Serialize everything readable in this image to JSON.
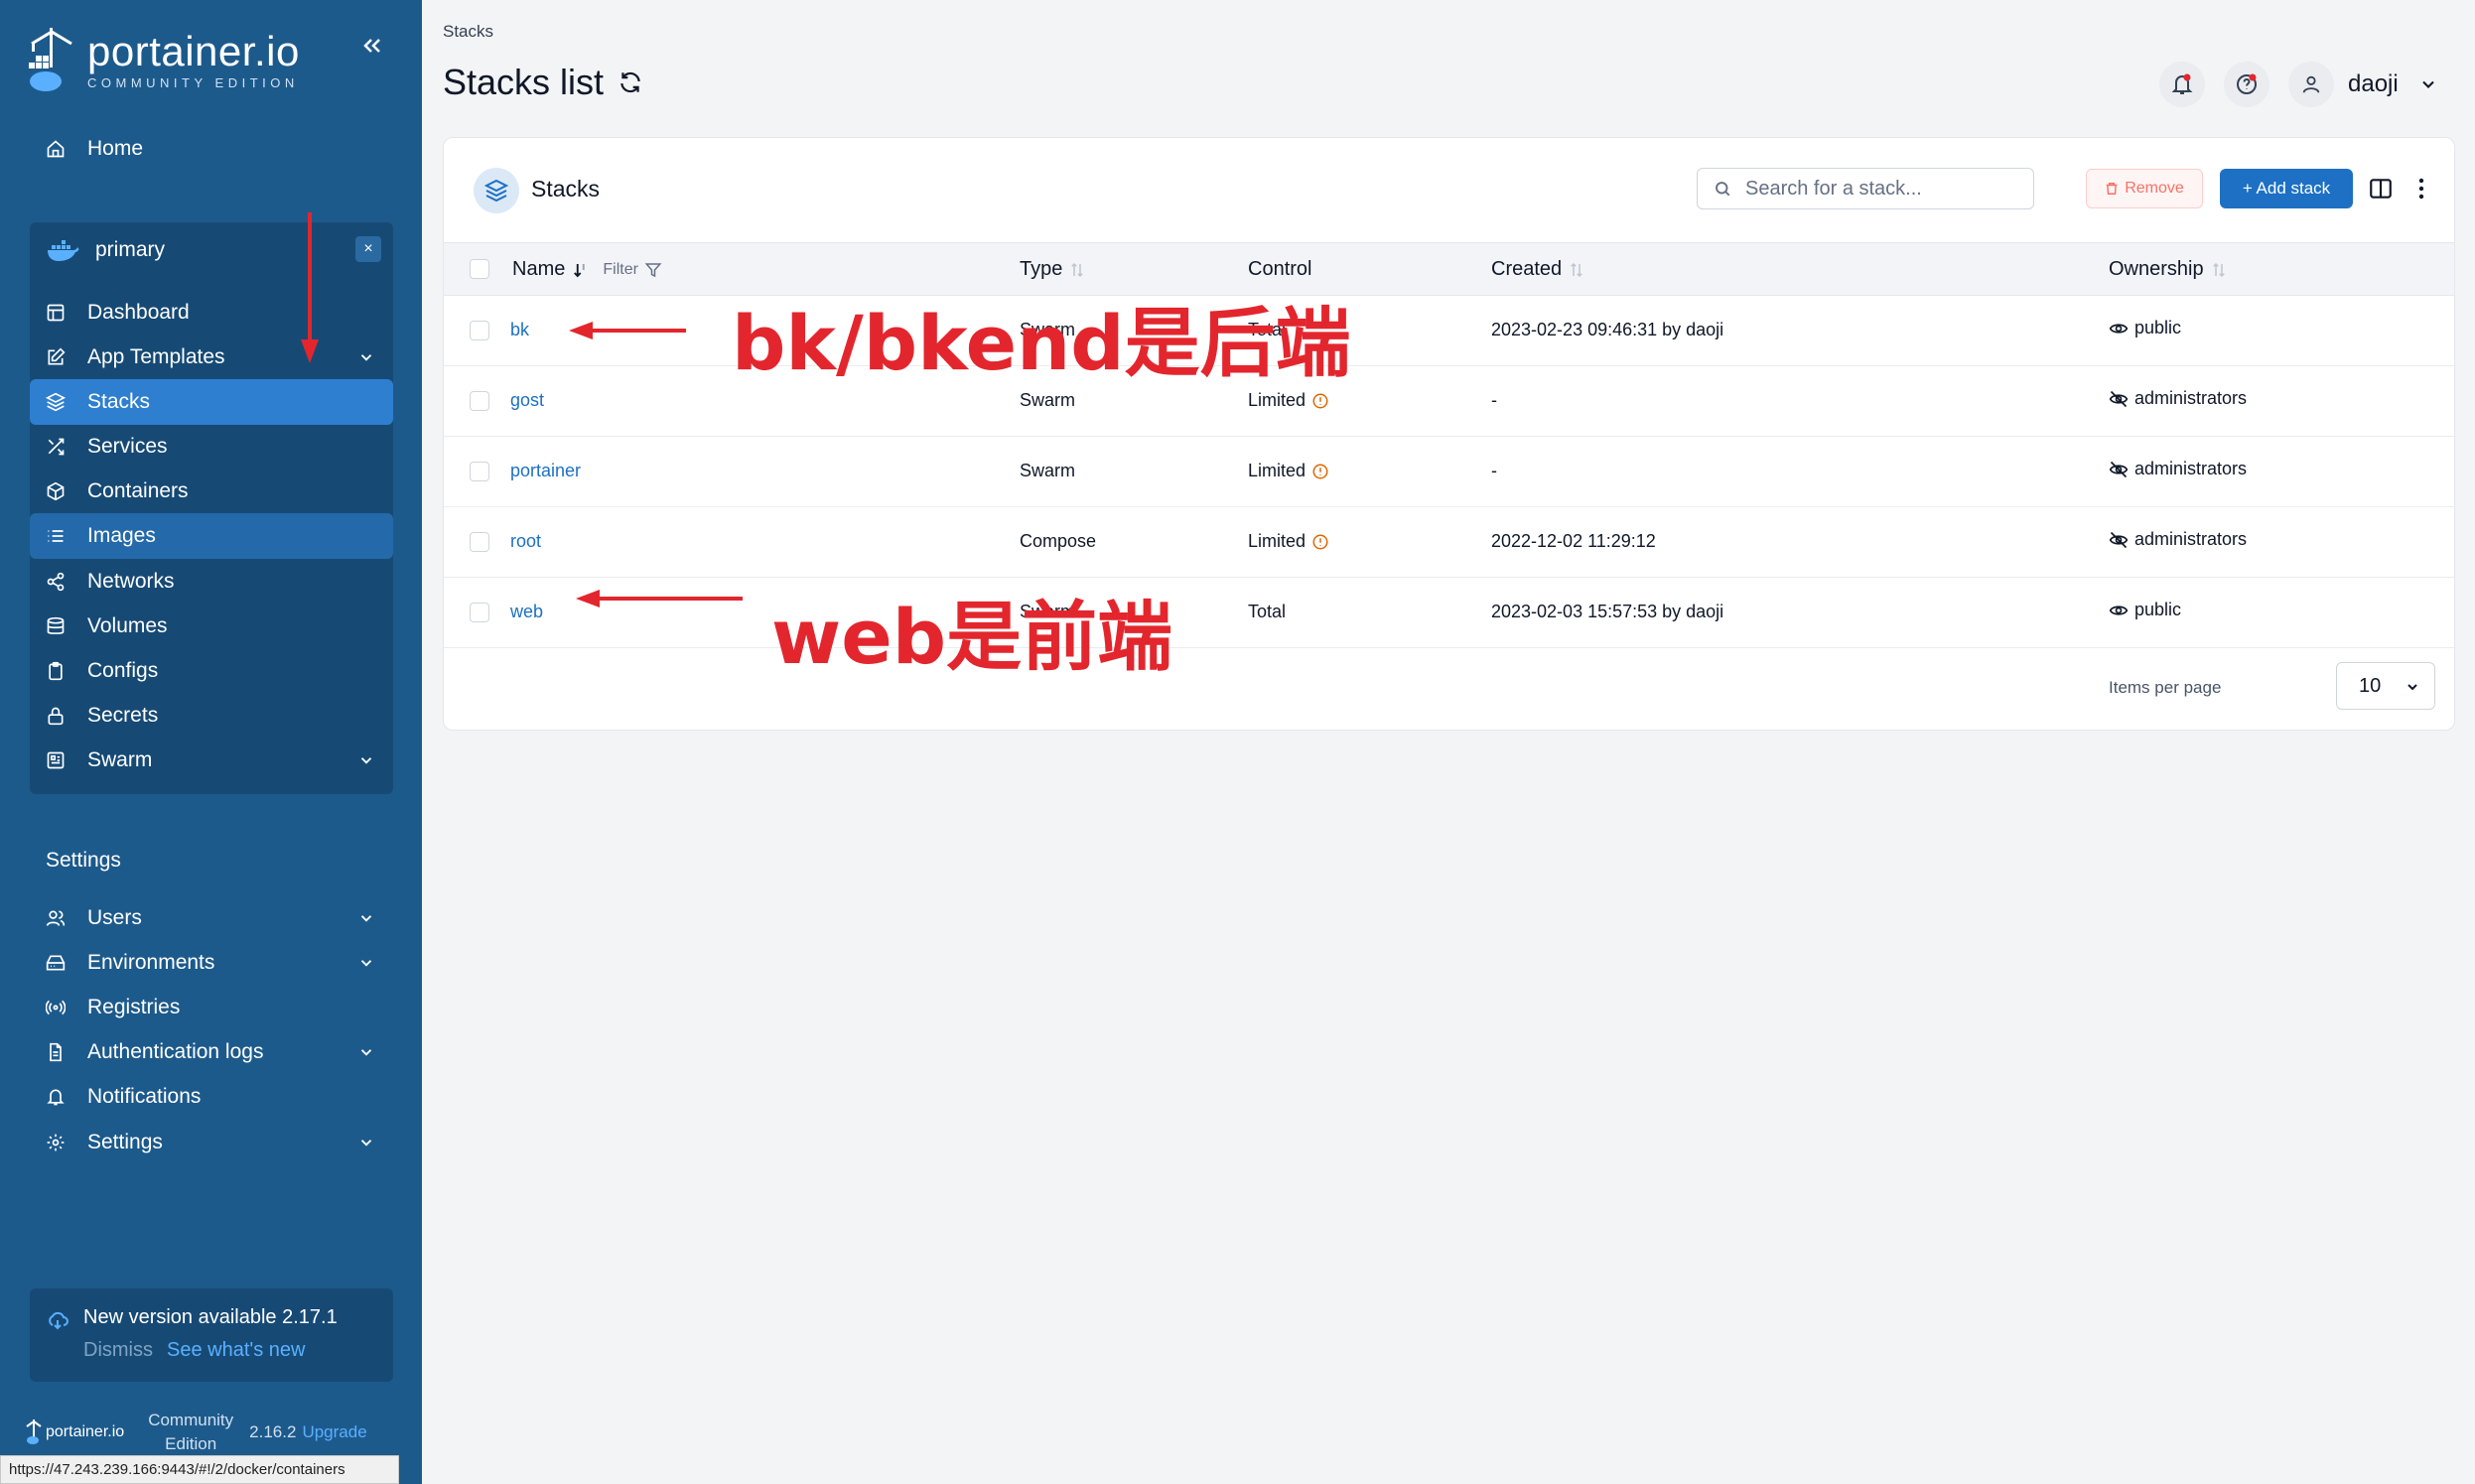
{
  "colors": {
    "sidebar": "#1d5a8c",
    "accent": "#1d70c4",
    "annotation": "#e3262d",
    "remove": "#f97066"
  },
  "sidebar": {
    "logo_name": "portainer.io",
    "logo_sub": "COMMUNITY EDITION",
    "home": "Home",
    "environment": {
      "name": "primary",
      "close": "×"
    },
    "env_items": [
      {
        "label": "Dashboard",
        "icon": "dashboard-icon"
      },
      {
        "label": "App Templates",
        "icon": "edit-icon"
      },
      {
        "label": "Stacks",
        "icon": "layers-icon"
      },
      {
        "label": "Services",
        "icon": "shuffle-icon"
      },
      {
        "label": "Containers",
        "icon": "box-icon"
      },
      {
        "label": "Images",
        "icon": "list-icon"
      },
      {
        "label": "Networks",
        "icon": "share-icon"
      },
      {
        "label": "Volumes",
        "icon": "database-icon"
      },
      {
        "label": "Configs",
        "icon": "clipboard-icon"
      },
      {
        "label": "Secrets",
        "icon": "lock-icon"
      },
      {
        "label": "Swarm",
        "icon": "swarm-icon"
      }
    ],
    "settings_heading": "Settings",
    "settings_items": [
      {
        "label": "Users",
        "icon": "users-icon"
      },
      {
        "label": "Environments",
        "icon": "hdd-icon"
      },
      {
        "label": "Registries",
        "icon": "radio-icon"
      },
      {
        "label": "Authentication logs",
        "icon": "file-icon"
      },
      {
        "label": "Notifications",
        "icon": "bell-icon"
      },
      {
        "label": "Settings",
        "icon": "gear-icon"
      }
    ],
    "update": {
      "title": "New version available 2.17.1",
      "dismiss": "Dismiss",
      "whats_new": "See what's new"
    },
    "footer": {
      "name": "portainer.io",
      "edition_line1": "Community",
      "edition_line2": "Edition",
      "version": "2.16.2",
      "upgrade": "Upgrade"
    }
  },
  "statusbar": "https://47.243.239.166:9443/#!/2/docker/containers",
  "header": {
    "breadcrumb": "Stacks",
    "title": "Stacks list",
    "user": "daoji"
  },
  "card": {
    "title": "Stacks",
    "search_placeholder": "Search for a stack...",
    "remove": "Remove",
    "add": "+ Add stack",
    "columns": {
      "name": "Name",
      "filter": "Filter",
      "type": "Type",
      "control": "Control",
      "created": "Created",
      "ownership": "Ownership"
    },
    "rows": [
      {
        "name": "bk",
        "type": "Swarm",
        "control": "Total",
        "limited": false,
        "created": "2023-02-23 09:46:31 by daoji",
        "ownership": "public",
        "public": true
      },
      {
        "name": "gost",
        "type": "Swarm",
        "control": "Limited",
        "limited": true,
        "created": "-",
        "ownership": "administrators",
        "public": false
      },
      {
        "name": "portainer",
        "type": "Swarm",
        "control": "Limited",
        "limited": true,
        "created": "-",
        "ownership": "administrators",
        "public": false
      },
      {
        "name": "root",
        "type": "Compose",
        "control": "Limited",
        "limited": true,
        "created": "2022-12-02 11:29:12",
        "ownership": "administrators",
        "public": false
      },
      {
        "name": "web",
        "type": "Swarm",
        "control": "Total",
        "limited": false,
        "created": "2023-02-03 15:57:53 by daoji",
        "ownership": "public",
        "public": true
      }
    ],
    "items_per_page_label": "Items per page",
    "items_per_page": "10"
  },
  "annotations": {
    "bk": "bk/bkend是后端",
    "web": "web是前端"
  }
}
